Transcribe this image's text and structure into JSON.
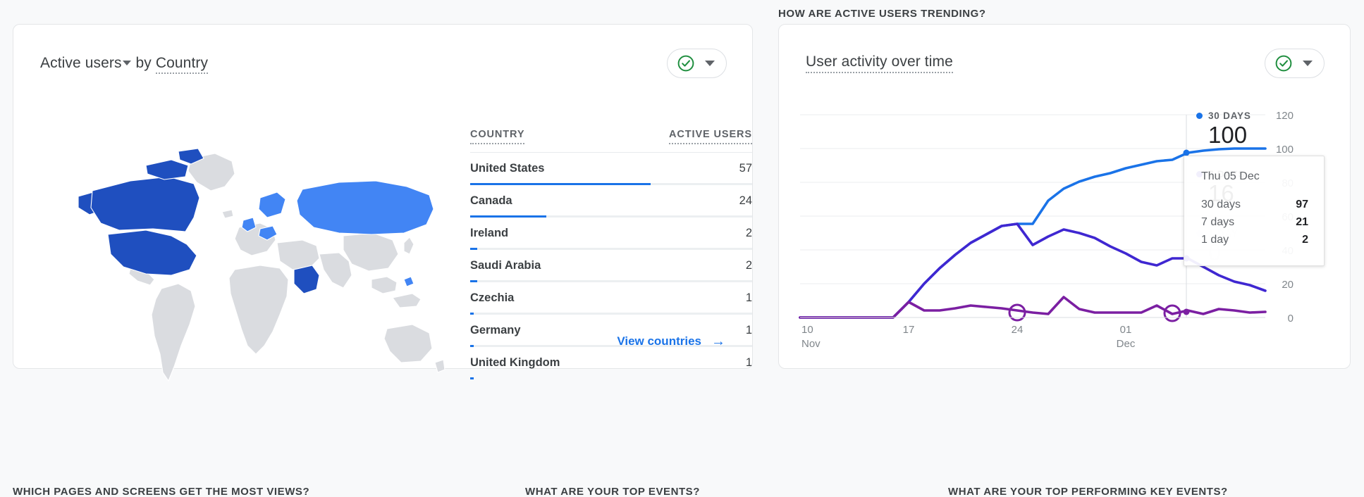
{
  "sections": {
    "trending_caption": "HOW ARE ACTIVE USERS TRENDING?",
    "bottom_captions": [
      "WHICH PAGES AND SCREENS GET THE MOST VIEWS?",
      "WHAT ARE YOUR TOP EVENTS?",
      "WHAT ARE YOUR TOP PERFORMING KEY EVENTS?"
    ]
  },
  "geo_card": {
    "title_metric": "Active users",
    "title_by": "by",
    "title_dimension": "Country",
    "columns": {
      "dimension": "COUNTRY",
      "metric": "ACTIVE USERS"
    },
    "rows": [
      {
        "country": "United States",
        "users": "57"
      },
      {
        "country": "Canada",
        "users": "24"
      },
      {
        "country": "Ireland",
        "users": "2"
      },
      {
        "country": "Saudi Arabia",
        "users": "2"
      },
      {
        "country": "Czechia",
        "users": "1"
      },
      {
        "country": "Germany",
        "users": "1"
      },
      {
        "country": "United Kingdom",
        "users": "1"
      }
    ],
    "footer_link": "View countries",
    "arrow_glyph": "→",
    "selector_icon": "check-circle-icon",
    "map": {
      "highlight_strong": "#1f4fbf",
      "highlight_light": "#4285f4",
      "base": "#dadce0"
    },
    "bar_color": "#1a73e8"
  },
  "trend_card": {
    "title": "User activity over time",
    "selector_icon": "check-circle-icon",
    "tooltip": {
      "date": "Thu 05 Dec",
      "rows": [
        {
          "label": "30 days",
          "value": "97"
        },
        {
          "label": "7 days",
          "value": "21"
        },
        {
          "label": "1 day",
          "value": "2"
        }
      ]
    },
    "legend": [
      {
        "label": "30 DAYS",
        "value": "100",
        "color": "#1a73e8"
      },
      {
        "label": "7 DAYS",
        "value": "16",
        "color": "#3f27d1"
      },
      {
        "label": "1 DAY",
        "value": "0",
        "color": "#7b1fa2"
      }
    ]
  },
  "chart_data": {
    "type": "line",
    "title": "User activity over time",
    "xlabel": "",
    "ylabel": "",
    "ylim": [
      0,
      120
    ],
    "yticks": [
      0,
      20,
      40,
      60,
      80,
      100,
      120
    ],
    "ytick_labels": [
      "0",
      "20",
      "40",
      "60",
      "80",
      "100",
      "120"
    ],
    "grid": true,
    "legend_position": "right",
    "x": [
      "10 Nov",
      "11 Nov",
      "12 Nov",
      "13 Nov",
      "14 Nov",
      "15 Nov",
      "16 Nov",
      "17 Nov",
      "18 Nov",
      "19 Nov",
      "20 Nov",
      "21 Nov",
      "22 Nov",
      "23 Nov",
      "24 Nov",
      "25 Nov",
      "26 Nov",
      "27 Nov",
      "28 Nov",
      "29 Nov",
      "30 Nov",
      "01 Dec",
      "02 Dec",
      "03 Dec",
      "04 Dec",
      "05 Dec",
      "06 Dec",
      "07 Dec",
      "08 Dec",
      "09 Dec"
    ],
    "xtick_labels": [
      "10\nNov",
      "17",
      "24",
      "01\nDec"
    ],
    "xtick_index": [
      0,
      7,
      14,
      21
    ],
    "series": [
      {
        "name": "30 days",
        "color": "#1a73e8",
        "values": [
          0,
          0,
          0,
          0,
          0,
          0,
          0,
          9,
          20,
          29,
          37,
          44,
          49,
          54,
          55,
          55,
          69,
          76,
          80,
          83,
          85,
          88,
          90,
          92,
          93,
          97,
          98,
          99,
          100,
          100
        ]
      },
      {
        "name": "7 days",
        "color": "#3f27d1",
        "values": [
          0,
          0,
          0,
          0,
          0,
          0,
          0,
          9,
          20,
          29,
          37,
          44,
          49,
          54,
          55,
          43,
          48,
          52,
          50,
          47,
          42,
          38,
          33,
          31,
          35,
          35,
          30,
          25,
          21,
          19
        ]
      },
      {
        "name": "1 day",
        "color": "#7b1fa2",
        "values": [
          0,
          0,
          0,
          0,
          0,
          0,
          0,
          9,
          4,
          4,
          5,
          7,
          6,
          5,
          4,
          3,
          2,
          12,
          5,
          3,
          3,
          3,
          3,
          7,
          2,
          4,
          2,
          5,
          4,
          3
        ]
      }
    ],
    "annotations": [
      {
        "type": "tooltip",
        "x": "05 Dec",
        "values": {
          "30 days": 97,
          "7 days": 21,
          "1 day": 2
        }
      }
    ]
  }
}
